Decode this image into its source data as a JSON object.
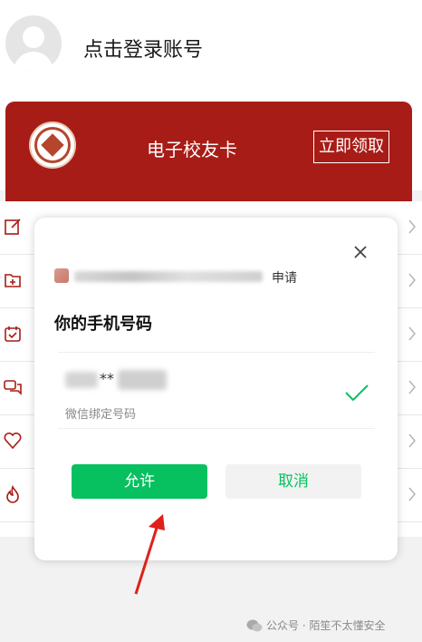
{
  "header": {
    "login_text": "点击登录账号"
  },
  "card": {
    "title": "电子校友卡",
    "claim_label": "立即领取",
    "background_color": "#a81c17"
  },
  "menu": {
    "icons": [
      "edit-icon",
      "add-folder-icon",
      "calendar-check-icon",
      "chat-icon",
      "heart-icon",
      "flame-icon"
    ]
  },
  "dialog": {
    "request_label": "申请",
    "title": "你的手机号码",
    "phone_masked": "**",
    "phone_note": "微信绑定号码",
    "allow_label": "允许",
    "cancel_label": "取消",
    "accent_color": "#07c160"
  },
  "watermark": {
    "text": "公众号 · 陌笙不太懂安全"
  }
}
